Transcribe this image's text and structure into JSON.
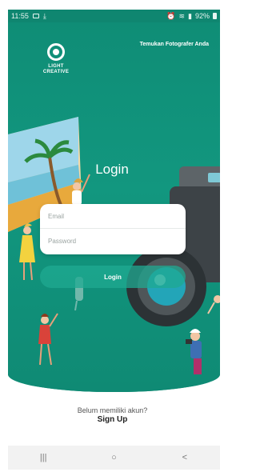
{
  "status_bar": {
    "time": "11:55",
    "battery": "92%",
    "left_icons": [
      "gallery-icon",
      "download-icon"
    ],
    "right_icons": [
      "alarm-icon",
      "wifi-icon",
      "signal-icon",
      "battery-icon"
    ]
  },
  "brand": {
    "logo_line1": "LIGHT",
    "logo_line2": "CREATIVE",
    "tagline": "Temukan Fotografer Anda"
  },
  "login": {
    "title": "Login",
    "email_placeholder": "Email",
    "password_placeholder": "Password",
    "button_label": "Login"
  },
  "signup": {
    "prompt": "Belum memiliki akun?",
    "link": "Sign Up"
  },
  "nav": {
    "recents": "|||",
    "home": "○",
    "back": "<"
  },
  "colors": {
    "primary": "#11947d",
    "status_bar": "#0f8670",
    "button": "#1faa91"
  }
}
